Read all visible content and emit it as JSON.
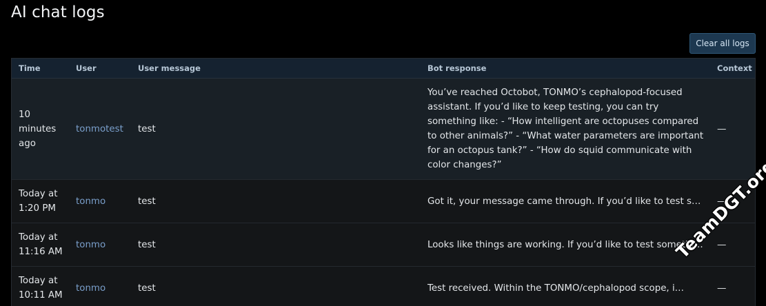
{
  "page": {
    "title": "AI chat logs",
    "clear_button": "Clear all logs"
  },
  "table": {
    "columns": {
      "time": "Time",
      "user": "User",
      "user_message": "User message",
      "bot_response": "Bot response",
      "context": "Context"
    },
    "rows": [
      {
        "time": "10 minutes ago",
        "user": "tonmotest",
        "user_message": "test",
        "bot_response": "You’ve reached Octobot, TONMO’s cephalopod-focused assistant. If you’d like to keep testing, you can try something like: - “How intelligent are octopuses compared to other animals?” - “What water parameters are important for an octopus tank?” - “How do squid communicate with color changes?”",
        "context": "—"
      },
      {
        "time": "Today at 1:20 PM",
        "user": "tonmo",
        "user_message": "test",
        "bot_response": "Got it, your message came through. If you’d like to test so…",
        "context": "—"
      },
      {
        "time": "Today at 11:16 AM",
        "user": "tonmo",
        "user_message": "test",
        "bot_response": "Looks like things are working. If you’d like to test somethin…",
        "context": "—"
      },
      {
        "time": "Today at 10:11 AM",
        "user": "tonmo",
        "user_message": "test",
        "bot_response": "Test received. Within the TONMO/cephalopod scope, i…",
        "context": "—"
      }
    ]
  },
  "watermark": "TeamDGT.org",
  "colors": {
    "background": "#000000",
    "header_bg": "#152230",
    "row_highlight_bg": "#192026",
    "row_bg": "#141618",
    "link": "#7a9fcb",
    "button_bg": "#1d3850"
  }
}
